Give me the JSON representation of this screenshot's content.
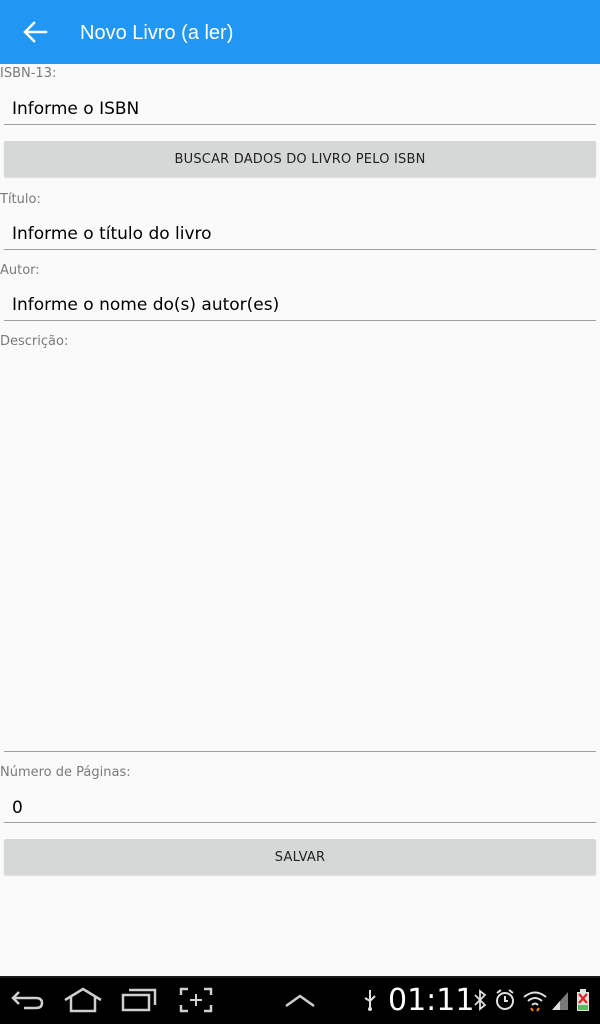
{
  "app_bar": {
    "title": "Novo Livro (a ler)",
    "back_icon": "arrow-back-icon",
    "color": "#2196f3"
  },
  "form": {
    "isbn": {
      "label": "ISBN-13:",
      "placeholder": "Informe o ISBN"
    },
    "search_button_label": "BUSCAR DADOS DO LIVRO PELO ISBN",
    "title": {
      "label": "Título:",
      "placeholder": "Informe o título do livro"
    },
    "author": {
      "label": "Autor:",
      "placeholder": "Informe o nome do(s) autor(es)"
    },
    "description": {
      "label": "Descrição:",
      "value": ""
    },
    "pages": {
      "label": "Número de Páginas:",
      "value": "0"
    },
    "save_button_label": "SALVAR"
  },
  "system_bar": {
    "clock": "01:11",
    "nav_icons": [
      "back-icon",
      "home-icon",
      "recent-apps-icon",
      "screenshot-icon",
      "menu-up-icon"
    ],
    "status_icons": [
      "usb-icon",
      "bluetooth-icon",
      "alarm-icon",
      "wifi-icon",
      "signal-icon",
      "battery-icon"
    ]
  }
}
